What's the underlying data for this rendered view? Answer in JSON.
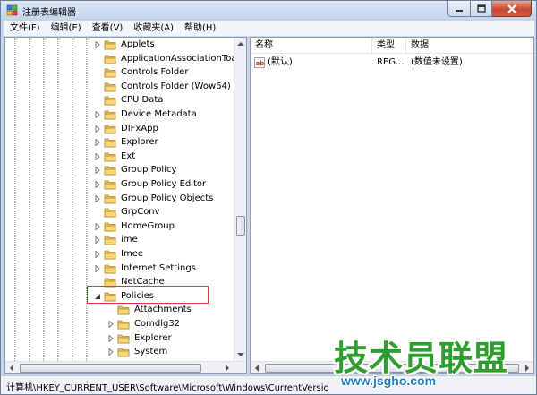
{
  "window": {
    "title": "注册表编辑器"
  },
  "menu": [
    {
      "label": "文件(F)"
    },
    {
      "label": "编辑(E)"
    },
    {
      "label": "查看(V)"
    },
    {
      "label": "收藏夹(A)"
    },
    {
      "label": "帮助(H)"
    }
  ],
  "tree": {
    "items": [
      {
        "label": "Applets",
        "level": 0,
        "expander": "collapsed",
        "selected": false
      },
      {
        "label": "ApplicationAssociationToasts",
        "level": 0,
        "expander": "none",
        "selected": false
      },
      {
        "label": "Controls Folder",
        "level": 0,
        "expander": "none",
        "selected": false
      },
      {
        "label": "Controls Folder (Wow64)",
        "level": 0,
        "expander": "none",
        "selected": false
      },
      {
        "label": "CPU Data",
        "level": 0,
        "expander": "none",
        "selected": false
      },
      {
        "label": "Device Metadata",
        "level": 0,
        "expander": "collapsed",
        "selected": false
      },
      {
        "label": "DIFxApp",
        "level": 0,
        "expander": "collapsed",
        "selected": false
      },
      {
        "label": "Explorer",
        "level": 0,
        "expander": "collapsed",
        "selected": false
      },
      {
        "label": "Ext",
        "level": 0,
        "expander": "collapsed",
        "selected": false
      },
      {
        "label": "Group Policy",
        "level": 0,
        "expander": "collapsed",
        "selected": false
      },
      {
        "label": "Group Policy Editor",
        "level": 0,
        "expander": "collapsed",
        "selected": false
      },
      {
        "label": "Group Policy Objects",
        "level": 0,
        "expander": "collapsed",
        "selected": false
      },
      {
        "label": "GrpConv",
        "level": 0,
        "expander": "none",
        "selected": false
      },
      {
        "label": "HomeGroup",
        "level": 0,
        "expander": "collapsed",
        "selected": false
      },
      {
        "label": "ime",
        "level": 0,
        "expander": "collapsed",
        "selected": false
      },
      {
        "label": "Imee",
        "level": 0,
        "expander": "collapsed",
        "selected": false
      },
      {
        "label": "Internet Settings",
        "level": 0,
        "expander": "collapsed",
        "selected": false
      },
      {
        "label": "NetCache",
        "level": 0,
        "expander": "none",
        "selected": false
      },
      {
        "label": "Policies",
        "level": 0,
        "expander": "expanded",
        "selected": true
      },
      {
        "label": "Attachments",
        "level": 1,
        "expander": "none",
        "selected": false
      },
      {
        "label": "Comdlg32",
        "level": 1,
        "expander": "collapsed",
        "selected": false
      },
      {
        "label": "Explorer",
        "level": 1,
        "expander": "collapsed",
        "selected": false
      },
      {
        "label": "System",
        "level": 1,
        "expander": "collapsed",
        "selected": false
      }
    ]
  },
  "list": {
    "columns": [
      {
        "label": "名称"
      },
      {
        "label": "类型"
      },
      {
        "label": "数据"
      }
    ],
    "rows": [
      {
        "icon": "string-value-icon",
        "name": "(默认)",
        "type": "REG...",
        "data": "(数值未设置)"
      }
    ]
  },
  "status_bar": {
    "path": "计算机\\HKEY_CURRENT_USER\\Software\\Microsoft\\Windows\\CurrentVersion\\Policies"
  },
  "watermark": {
    "brand": "技术员联盟",
    "url": "www.jsgho.com"
  },
  "colors": {
    "folder": "#e8c25a",
    "selection_outline": "#d93b3b",
    "watermark_green": "#2f9e2f",
    "watermark_blue": "#1e7fc2"
  }
}
